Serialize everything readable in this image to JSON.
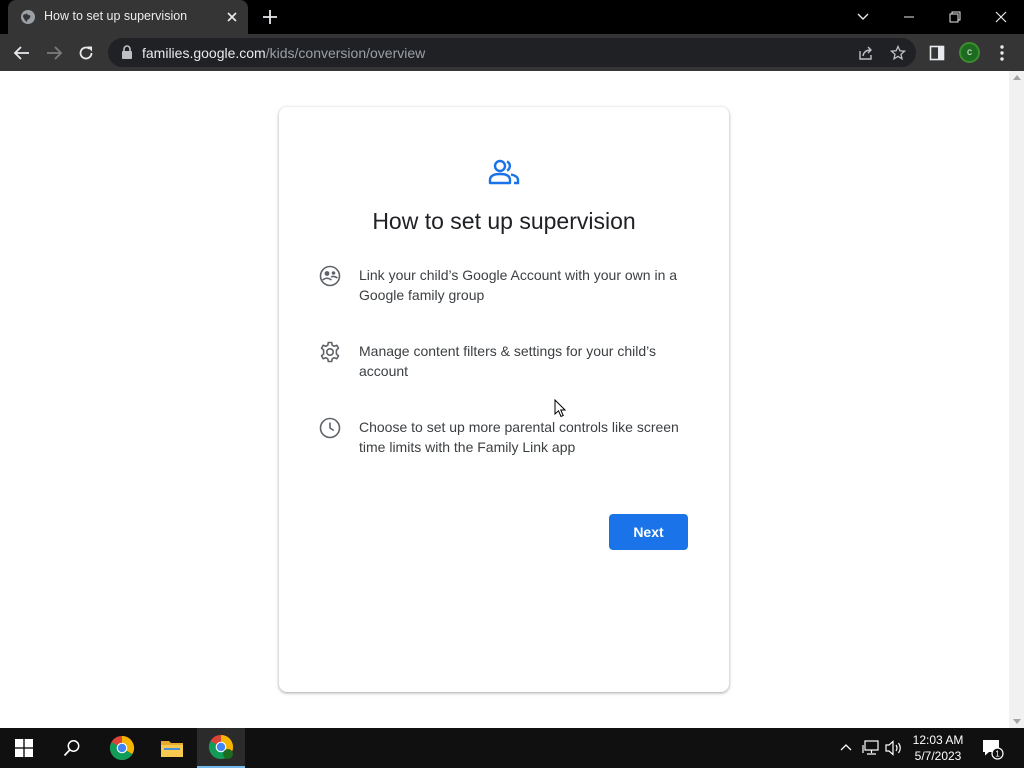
{
  "browser": {
    "tab_title": "How to set up supervision",
    "url_host": "families.google.com",
    "url_path": "/kids/conversion/overview",
    "profile_initial": "c"
  },
  "page": {
    "title": "How to set up supervision",
    "steps": [
      {
        "icon": "family-group-icon",
        "text": "Link your child’s Google Account with your own in a Google family group"
      },
      {
        "icon": "gear-icon",
        "text": "Manage content filters & settings for your child’s account"
      },
      {
        "icon": "clock-icon",
        "text": "Choose to set up more parental controls like screen time limits with the Family Link app"
      }
    ],
    "next_label": "Next"
  },
  "taskbar": {
    "time": "12:03 AM",
    "date": "5/7/2023",
    "notification_count": "1"
  },
  "colors": {
    "accent": "#1a73e8",
    "chrome_frame": "#000000",
    "chrome_toolbar": "#353535",
    "omnibox": "#202124"
  }
}
